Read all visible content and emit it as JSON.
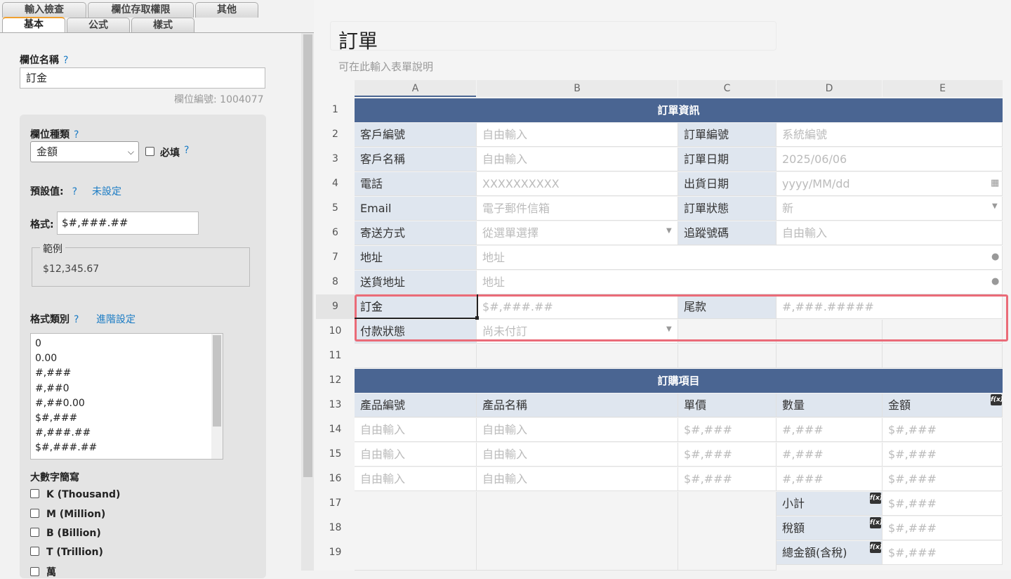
{
  "tabs_row1": [
    "輸入檢查",
    "欄位存取權限",
    "其他"
  ],
  "tabs_row2": [
    "基本",
    "公式",
    "樣式"
  ],
  "field_name": {
    "label": "欄位名稱",
    "help": "?",
    "value": "訂金",
    "id_text": "欄位編號: 1004077"
  },
  "field_type": {
    "label": "欄位種類",
    "help": "?",
    "value": "金額",
    "required_label": "必填",
    "required_help": "?"
  },
  "default": {
    "label": "預設值:",
    "help": "?",
    "value": "未設定"
  },
  "format": {
    "label": "格式:",
    "value": "$#,###.##"
  },
  "example": {
    "legend": "範例",
    "value": "$12,345.67"
  },
  "format_type": {
    "label": "格式類別",
    "help": "?",
    "advanced": "進階設定",
    "options": [
      "0",
      "0.00",
      "#,###",
      "#,##0",
      "#,##0.00",
      "$#,###",
      "#,###.##",
      "$#,###.##"
    ]
  },
  "big_number": {
    "label": "大數字簡寫",
    "options": [
      "K (Thousand)",
      "M (Million)",
      "B (Billion)",
      "T (Trillion)",
      "萬"
    ]
  },
  "form": {
    "title": "訂單",
    "description": "可在此輸入表單說明"
  },
  "columns": [
    "A",
    "B",
    "C",
    "D",
    "E"
  ],
  "rows": [
    "1",
    "2",
    "3",
    "4",
    "5",
    "6",
    "7",
    "8",
    "9",
    "10",
    "11",
    "12",
    "13",
    "14",
    "15",
    "16",
    "17",
    "18",
    "19"
  ],
  "sheet": {
    "header1": "訂單資訊",
    "r2": {
      "a": "客戶編號",
      "b": "自由輸入",
      "c": "訂單編號",
      "d": "系統編號"
    },
    "r3": {
      "a": "客戶名稱",
      "b": "自由輸入",
      "c": "訂單日期",
      "d": "2025/06/06"
    },
    "r4": {
      "a": "電話",
      "b": "XXXXXXXXXX",
      "c": "出貨日期",
      "d": "yyyy/MM/dd"
    },
    "r5": {
      "a": "Email",
      "b": "電子郵件信箱",
      "c": "訂單狀態",
      "d": "新"
    },
    "r6": {
      "a": "寄送方式",
      "b": "從選單選擇",
      "c": "追蹤號碼",
      "d": "自由輸入"
    },
    "r7": {
      "a": "地址",
      "b": "地址"
    },
    "r8": {
      "a": "送貨地址",
      "b": "地址"
    },
    "r9": {
      "a": "訂金",
      "b": "$#,###.##",
      "c": "尾款",
      "d": "#,###.#####"
    },
    "r10": {
      "a": "付款狀態",
      "b": "尚未付訂"
    },
    "header2": "訂購項目",
    "r13": {
      "a": "產品編號",
      "b": "產品名稱",
      "c": "單價",
      "d": "數量",
      "e": "金額"
    },
    "item_rows": [
      {
        "a": "自由輸入",
        "b": "自由輸入",
        "c": "$#,###",
        "d": "#,###",
        "e": "$#,###"
      },
      {
        "a": "自由輸入",
        "b": "自由輸入",
        "c": "$#,###",
        "d": "#,###",
        "e": "$#,###"
      },
      {
        "a": "自由輸入",
        "b": "自由輸入",
        "c": "$#,###",
        "d": "#,###",
        "e": "$#,###"
      }
    ],
    "totals": [
      {
        "d": "小計",
        "e": "$#,###"
      },
      {
        "d": "稅額",
        "e": "$#,###"
      },
      {
        "d": "總金額(含稅)",
        "e": "$#,###"
      }
    ]
  }
}
